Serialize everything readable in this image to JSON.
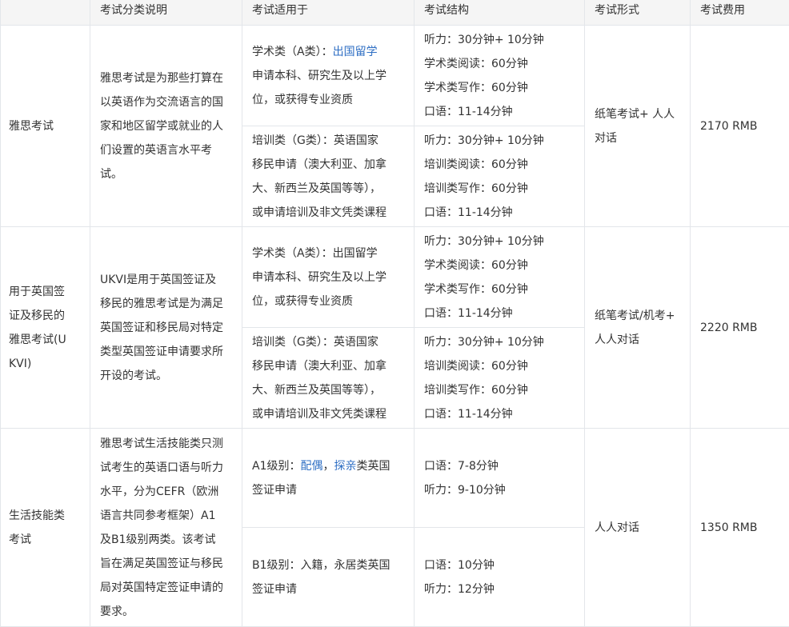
{
  "headers": [
    "考试分类说明",
    "考试适用于",
    "考试结构",
    "考试形式",
    "考试费用"
  ],
  "rows": [
    {
      "name": [
        "雅思考试"
      ],
      "description": [
        "雅思考试是为那些打算在",
        "以英语作为交流语言的国",
        "家和地区留学或就业的人",
        "们设置的英语言水平考",
        "试。"
      ],
      "format": [
        "纸笔考试+ 人人",
        "对话"
      ],
      "fee": "2170 RMB",
      "sub": [
        {
          "applies": [
            {
              "prefix": "学术类（A类）：",
              "link": "出国留学"
            },
            {
              "text": "申请本科、研究生及以上学"
            },
            {
              "text": "位，或获得专业资质"
            }
          ],
          "structure": [
            "听力：30分钟+ 10分钟",
            "学术类阅读：60分钟",
            "学术类写作：60分钟",
            "口语：11-14分钟"
          ]
        },
        {
          "applies": [
            {
              "text": "培训类（G类）：英语国家"
            },
            {
              "text": "移民申请（澳大利亚、加拿"
            },
            {
              "text": "大、新西兰及英国等等），"
            },
            {
              "text": "或申请培训及非文凭类课程"
            }
          ],
          "structure": [
            "听力：30分钟+ 10分钟",
            "培训类阅读：60分钟",
            "培训类写作：60分钟",
            "口语：11-14分钟"
          ]
        }
      ]
    },
    {
      "name": [
        "用于英国签",
        "证及移民的",
        "雅思考试(U",
        "KVI)"
      ],
      "description": [
        "UKVI是用于英国签证及",
        "移民的雅思考试是为满足",
        "英国签证和移民局对特定",
        "类型英国签证申请要求所",
        "开设的考试。"
      ],
      "format": [
        "纸笔考试/机考+",
        "人人对话"
      ],
      "fee": "2220 RMB",
      "sub": [
        {
          "applies": [
            {
              "text": "学术类（A类）：出国留学"
            },
            {
              "text": "申请本科、研究生及以上学"
            },
            {
              "text": "位，或获得专业资质"
            }
          ],
          "structure": [
            "听力：30分钟+ 10分钟",
            "学术类阅读：60分钟",
            "学术类写作：60分钟",
            "口语：11-14分钟"
          ]
        },
        {
          "applies": [
            {
              "text": "培训类（G类）：英语国家"
            },
            {
              "text": "移民申请（澳大利亚、加拿"
            },
            {
              "text": "大、新西兰及英国等等），"
            },
            {
              "text": "或申请培训及非文凭类课程"
            }
          ],
          "structure": [
            "听力：30分钟+ 10分钟",
            "培训类阅读：60分钟",
            "培训类写作：60分钟",
            "口语：11-14分钟"
          ]
        }
      ]
    },
    {
      "name": [
        "生活技能类",
        "考试"
      ],
      "description": [
        "雅思考试生活技能类只测",
        "试考生的英语口语与听力",
        "水平，分为CEFR（欧洲",
        "语言共同参考框架）A1",
        "及B1级别两类。该考试",
        "旨在满足英国签证与移民",
        "局对英国特定签证申请的",
        "要求。"
      ],
      "format": [
        "人人对话"
      ],
      "fee": "1350 RMB",
      "sub": [
        {
          "applies": [
            {
              "prefix": "A1级别：",
              "link": "配偶",
              "mid": "，",
              "link2": "探亲",
              "suffix": "类英国"
            },
            {
              "text": "签证申请"
            }
          ],
          "structure": [
            "口语：7-8分钟",
            "听力：9-10分钟"
          ]
        },
        {
          "applies": [
            {
              "text": "B1级别：入籍，永居类英国"
            },
            {
              "text": "签证申请"
            }
          ],
          "structure": [
            "口语：10分钟",
            "听力：12分钟"
          ]
        }
      ]
    }
  ]
}
